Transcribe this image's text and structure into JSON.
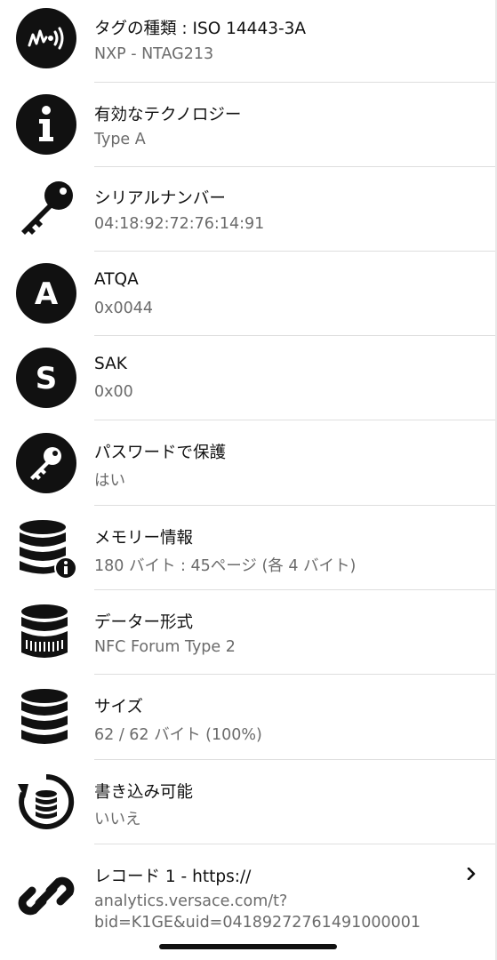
{
  "rows": [
    {
      "title": "タグの種類 : ISO 14443-3A",
      "value": "NXP - NTAG213",
      "icon": "nfc-tag-icon"
    },
    {
      "title": "有効なテクノロジー",
      "value": "Type A",
      "icon": "info-icon"
    },
    {
      "title": "シリアルナンバー",
      "value": "04:18:92:72:76:14:91",
      "icon": "key-icon"
    },
    {
      "title": "ATQA",
      "value": "0x0044",
      "icon": "letter-a-icon"
    },
    {
      "title": "SAK",
      "value": "0x00",
      "icon": "letter-s-icon"
    },
    {
      "title": "パスワードで保護",
      "value": "はい",
      "icon": "key-circle-icon"
    },
    {
      "title": "メモリー情報",
      "value": "180 バイト : 45ページ (各 4 バイト)",
      "icon": "database-info-icon"
    },
    {
      "title": "データー形式",
      "value": "NFC Forum Type 2",
      "icon": "database-format-icon"
    },
    {
      "title": "サイズ",
      "value": "62 / 62 バイト (100%)",
      "icon": "database-icon"
    },
    {
      "title": "書き込み可能",
      "value": "いいえ",
      "icon": "database-refresh-icon"
    }
  ],
  "record": {
    "title": "レコード 1 - https://",
    "value_line1": "analytics.versace.com/t?",
    "value_line2": "bid=K1GE&uid=04189272761491000001",
    "icon": "link-icon",
    "chevron": "chevron-right-icon"
  }
}
